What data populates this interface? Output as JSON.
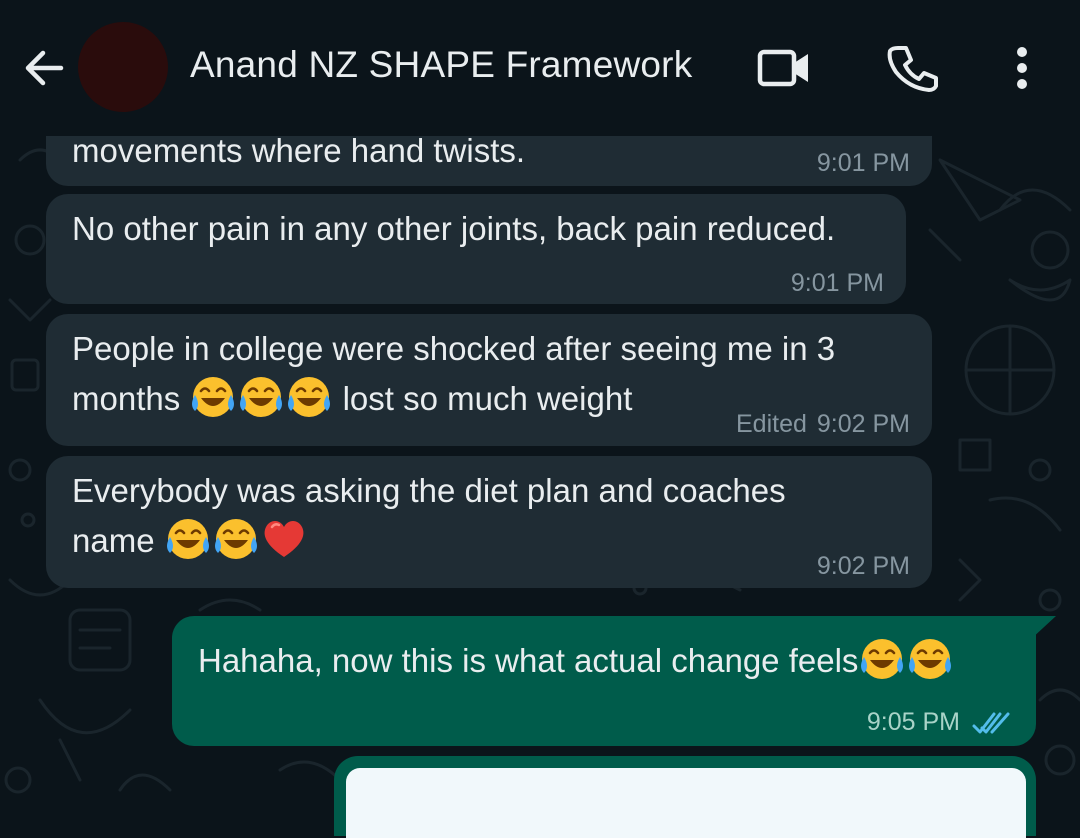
{
  "header": {
    "title": "Anand NZ SHAPE Framework"
  },
  "messages": [
    {
      "direction": "incoming",
      "text": "movements where hand twists.",
      "time": "9:01 PM"
    },
    {
      "direction": "incoming",
      "text": "No other pain in any other joints, back pain reduced.",
      "time": "9:01 PM"
    },
    {
      "direction": "incoming",
      "line1": "People in college were shocked after seeing me in 3",
      "line2_before": "months",
      "line2_after": "lost so much weight",
      "edited_label": "Edited",
      "time": "9:02 PM"
    },
    {
      "direction": "incoming",
      "line1": "Everybody was asking the diet plan and coaches",
      "line2": "name",
      "time": "9:02 PM"
    },
    {
      "direction": "outgoing",
      "text": "Hahaha, now this is what actual change feels",
      "time": "9:05 PM",
      "status": "read"
    }
  ],
  "colors": {
    "background": "#0b141a",
    "incoming_bubble": "#1f2c34",
    "outgoing_bubble": "#005c4b",
    "read_ticks": "#53bdeb"
  },
  "icons": {
    "back": "arrow-left-icon",
    "video": "video-camera-icon",
    "call": "phone-icon",
    "menu": "more-vertical-icon",
    "emoji_laugh": "face-with-tears-of-joy",
    "emoji_heart": "red-heart"
  }
}
